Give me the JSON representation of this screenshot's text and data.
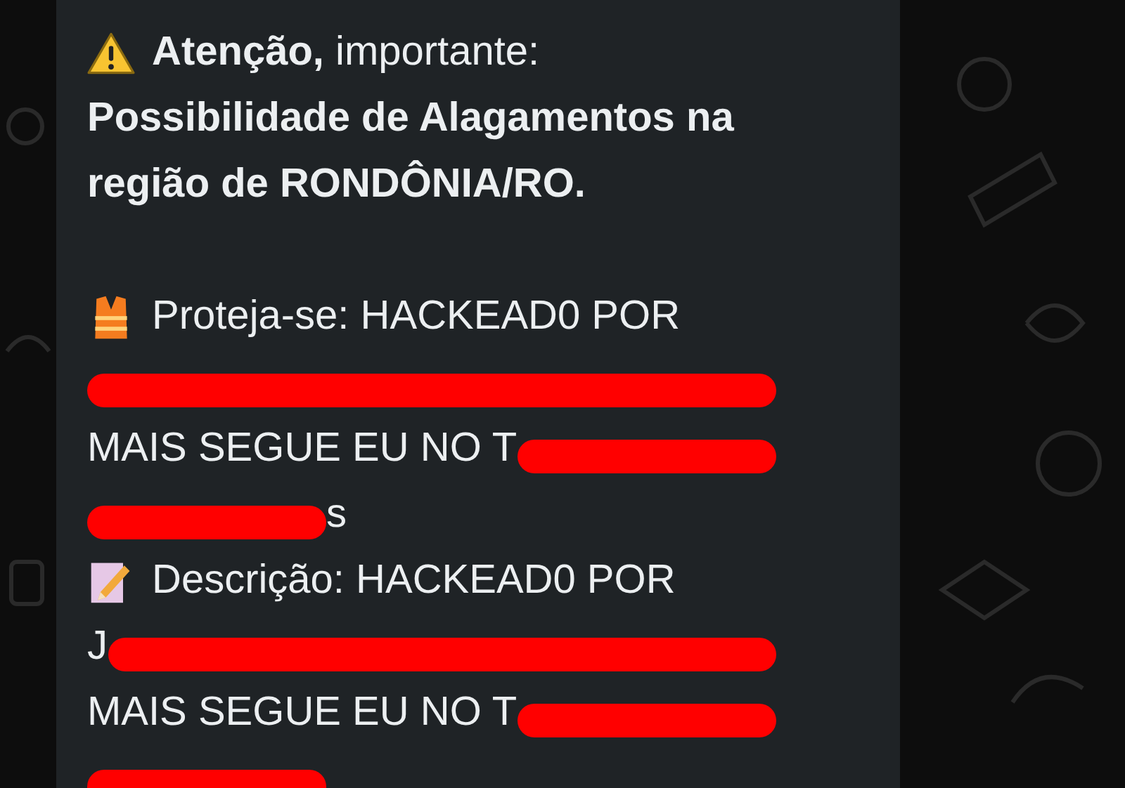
{
  "message": {
    "lines": [
      {
        "kind": "text",
        "parts": [
          {
            "kind": "warning"
          },
          {
            "kind": "text",
            "bold": false,
            "text": "**Atenção,** importante:"
          }
        ]
      },
      {
        "kind": "text",
        "parts": [
          {
            "kind": "text",
            "bold": true,
            "text": "Possibilidade de Alagamentos na"
          }
        ]
      },
      {
        "kind": "text",
        "parts": [
          {
            "kind": "text",
            "bold": true,
            "text": "região de RONDÔNIA/RO."
          }
        ]
      },
      {
        "kind": "blank"
      },
      {
        "kind": "text",
        "parts": [
          {
            "kind": "vest"
          },
          {
            "kind": "text",
            "bold": false,
            "text": "Proteja-se: HACKEAD0 POR"
          }
        ]
      },
      {
        "kind": "text",
        "parts": [
          {
            "kind": "strike"
          }
        ]
      },
      {
        "kind": "text",
        "parts": [
          {
            "kind": "text",
            "bold": false,
            "text": "MAIS SEGUE EU NO T"
          },
          {
            "kind": "strike"
          }
        ]
      },
      {
        "kind": "text",
        "parts": [
          {
            "kind": "scribble"
          },
          {
            "kind": "text",
            "bold": false,
            "text": "s"
          }
        ]
      },
      {
        "kind": "text",
        "parts": [
          {
            "kind": "memo"
          },
          {
            "kind": "text",
            "bold": false,
            "text": "Descrição: HACKEAD0 POR"
          }
        ]
      },
      {
        "kind": "text",
        "parts": [
          {
            "kind": "text",
            "bold": false,
            "text": "J"
          },
          {
            "kind": "strike"
          }
        ]
      },
      {
        "kind": "text",
        "parts": [
          {
            "kind": "text",
            "bold": false,
            "text": "MAIS SEGUE EU NO T"
          },
          {
            "kind": "strike"
          }
        ]
      },
      {
        "kind": "text",
        "parts": [
          {
            "kind": "scribble"
          }
        ]
      }
    ]
  }
}
